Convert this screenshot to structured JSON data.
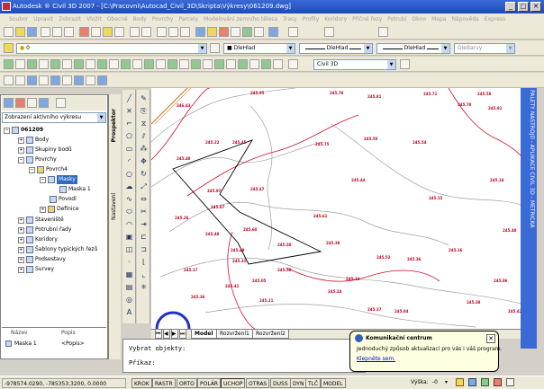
{
  "window": {
    "title": "Autodesk ® Civil 3D 2007 - [C:\\Pracovni\\Autocad_Civil_3D\\Skripta\\Výkresy\\061209.dwg]",
    "min": "_",
    "max": "□",
    "close": "✕"
  },
  "menu": [
    "Soubor",
    "Upravit",
    "Zobrazit",
    "Vložit",
    "Obecné",
    "Body",
    "Povrchy",
    "Parcely",
    "Modelování zemního tělesa",
    "Trasy",
    "Profily",
    "Koridory",
    "Příčné řezy",
    "Potrubí",
    "Okno",
    "Mapa",
    "Nápověda",
    "Express"
  ],
  "toolbar": {
    "layer_value": "0",
    "color_value": "DleHlad",
    "linetype_value": "DleHlad",
    "lineweight_value": "DleHlad",
    "plotstyle_value": "DleBarvy",
    "workspace_value": "Civil 3D"
  },
  "toolspace": {
    "view_select": "Zobrazení aktivního výkresu",
    "tree": {
      "root": "061209",
      "body": "Body",
      "skupiny": "Skupiny bodů",
      "povrchy": "Povrchy",
      "povrch4": "Povrch4",
      "masky": "Masky",
      "maska1": "Maska 1",
      "povodi": "Povodí",
      "definice": "Definice",
      "staveniste": "Staveniště",
      "potrubni": "Potrubní řady",
      "koridory": "Koridory",
      "sablony": "Šablony typických řezů",
      "podsestavy": "Podsestavy",
      "survey": "Survey"
    },
    "props": {
      "col_name": "Název",
      "col_desc": "Popis",
      "row_name": "Maska 1",
      "row_desc": "<Popis>"
    },
    "tabs": [
      "Prospektor",
      "Nastavení"
    ]
  },
  "drawing": {
    "labels": [
      "246.43",
      "245.95",
      "245.78",
      "245.81",
      "245.71",
      "245.58",
      "245.81",
      "245.78",
      "245.22",
      "245.45",
      "245.75",
      "245.50",
      "245.54",
      "245.48",
      "245.47",
      "245.87",
      "245.60",
      "245.48",
      "245.31",
      "245.28",
      "245.38",
      "245.52",
      "245.36",
      "245.16",
      "245.41",
      "245.05",
      "245.13",
      "245.24",
      "245.17",
      "245.36",
      "245.11",
      "245.37",
      "245.04",
      "245.38",
      "245.06",
      "245.14",
      "245.44",
      "245.97",
      "245.49",
      "245.58",
      "245.26",
      "245.15",
      "245.48",
      "245.61",
      "245.42"
    ],
    "tabs": [
      "Model",
      "Rozvržení1",
      "Rozvržení2"
    ]
  },
  "right_palette": "PALETY NÁSTROJŮ - APLIKACE CIVIL 3D - METRICKÁ",
  "cmdline": {
    "line1": "Vybrat objekty:",
    "line2": "Příkaz:"
  },
  "statusbar": {
    "coords": "-978574.0290, -785353.3200, 0.0000",
    "buttons": [
      "KROK",
      "RASTR",
      "ORTO",
      "POLÁR",
      "UCHOP",
      "OTRAS",
      "DUSS",
      "DYN",
      "TLČ",
      "MODEL"
    ],
    "height_label": "Výška:",
    "height_value": "-0"
  },
  "balloon": {
    "title": "Komunikační centrum",
    "text": "Jednoduchý způsob aktualizací pro vás i váš program.",
    "link": "Klepněte sem."
  },
  "colors": {
    "titlebar": "#1c4ab8",
    "contour_red": "#d01030",
    "contour_gray": "#a0a0a0",
    "palette_blue": "#3a6ad8"
  }
}
